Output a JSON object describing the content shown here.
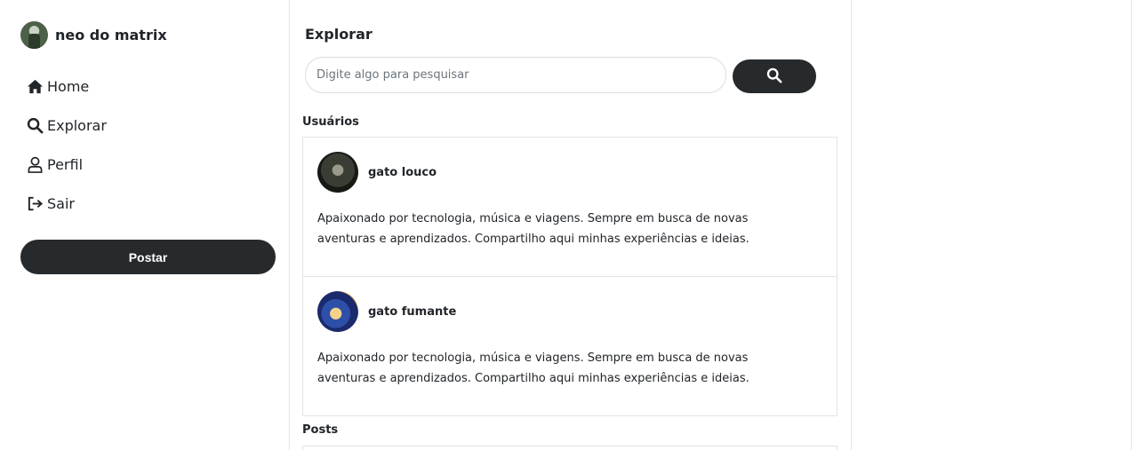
{
  "user": {
    "name": "neo do matrix"
  },
  "nav": {
    "items": [
      {
        "label": "Home",
        "icon": "home-icon"
      },
      {
        "label": "Explorar",
        "icon": "search-icon"
      },
      {
        "label": "Perfil",
        "icon": "user-icon"
      },
      {
        "label": "Sair",
        "icon": "logout-icon"
      }
    ],
    "post_label": "Postar"
  },
  "main": {
    "title": "Explorar",
    "search": {
      "placeholder": "Digite algo para pesquisar",
      "value": ""
    },
    "users_label": "Usuários",
    "users": [
      {
        "name": "gato louco",
        "bio": "Apaixonado por tecnologia, música e viagens. Sempre em busca de novas aventuras e aprendizados. Compartilho aqui minhas experiências e ideias."
      },
      {
        "name": "gato fumante",
        "bio": "Apaixonado por tecnologia, música e viagens. Sempre em busca de novas aventuras e aprendizados. Compartilho aqui minhas experiências e ideias."
      }
    ],
    "posts_label": "Posts"
  },
  "colors": {
    "accent": "#262a2d",
    "border": "#e3e3e3",
    "text": "#212529"
  }
}
